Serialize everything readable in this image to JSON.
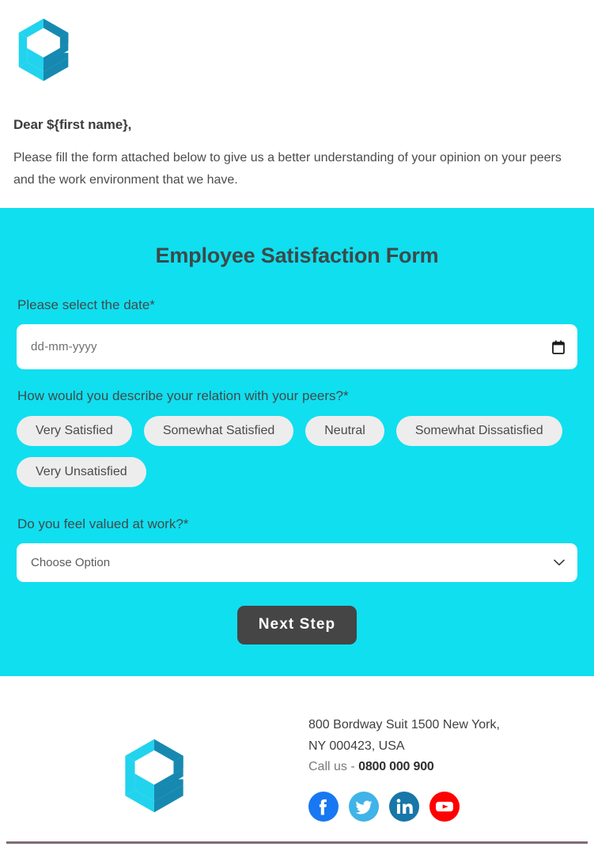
{
  "colors": {
    "panel_cyan": "#10dff0",
    "button_dark": "#454545",
    "pill_grey": "#ededed",
    "logo_dark_teal": "#1789b0",
    "logo_bright_cyan": "#22d3ee",
    "facebook": "#1877f2",
    "twitter": "#1da1f2",
    "linkedin": "#0a66c2",
    "youtube": "#ff0000",
    "bottom_rule": "#7d6b77"
  },
  "intro": {
    "logo_name": "company-logo",
    "greeting": "Dear ${first name},",
    "body": "Please fill the form attached below to give us a better understanding of your opinion on your peers and the work environment that we have."
  },
  "form": {
    "title": "Employee Satisfaction Form",
    "date_question": {
      "label": "Please select the date*",
      "placeholder": "dd-mm-yyyy",
      "value": "",
      "icon": "calendar-icon"
    },
    "peers_question": {
      "label": "How would you describe your relation with your peers?*",
      "options": [
        "Very Satisfied",
        "Somewhat Satisfied",
        "Neutral",
        "Somewhat Dissatisfied",
        "Very Unsatisfied"
      ]
    },
    "valued_question": {
      "label": "Do you feel valued at work?*",
      "selected": "Choose Option",
      "icon": "chevron-down-icon"
    },
    "submit_label": "Next Step"
  },
  "footer": {
    "logo_name": "company-logo",
    "address_line1": "800 Bordway Suit 1500 New York,",
    "address_line2": "NY 000423, USA",
    "call_prefix": "Call us - ",
    "phone": "0800 000 900",
    "social": [
      {
        "name": "facebook-icon",
        "label": "Facebook"
      },
      {
        "name": "twitter-icon",
        "label": "Twitter"
      },
      {
        "name": "linkedin-icon",
        "label": "LinkedIn"
      },
      {
        "name": "youtube-icon",
        "label": "YouTube"
      }
    ]
  }
}
